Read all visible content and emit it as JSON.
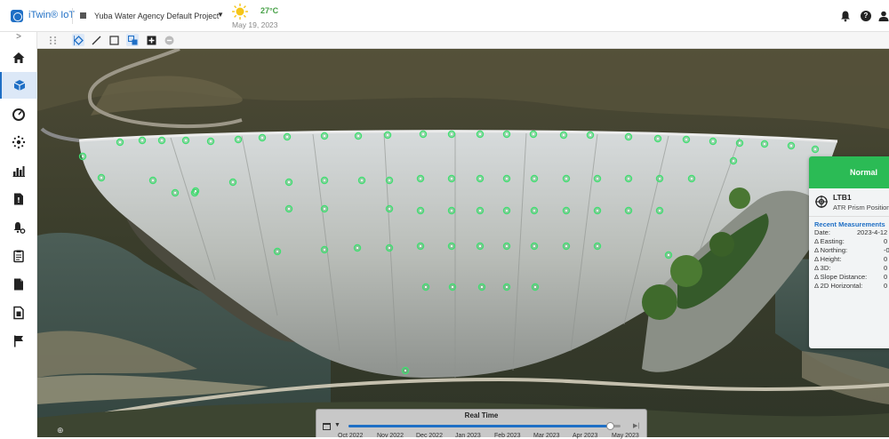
{
  "header": {
    "app_title": "iTwin® IoT",
    "project_name": "Yuba Water Agency Default Project",
    "weather_icon": "sun-icon",
    "temperature": "27°C",
    "date": "May 19, 2023",
    "icons": [
      "bell-icon",
      "help-icon",
      "user-icon"
    ]
  },
  "sidebar": {
    "collapse_glyph": ">",
    "items": [
      {
        "icon": "home-icon",
        "active": false
      },
      {
        "icon": "cube-icon",
        "active": true
      },
      {
        "icon": "gauge-icon",
        "active": false
      },
      {
        "icon": "network-icon",
        "active": false
      },
      {
        "icon": "bar-chart-icon",
        "active": false
      },
      {
        "icon": "alert-document-icon",
        "active": false
      },
      {
        "icon": "bell-settings-icon",
        "active": false
      },
      {
        "icon": "clipboard-icon",
        "active": false
      },
      {
        "icon": "document-icon",
        "active": false
      },
      {
        "icon": "report-icon",
        "active": false
      },
      {
        "icon": "flag-icon",
        "active": false
      }
    ]
  },
  "toolbar": {
    "tools": [
      "drag-handle-icon",
      "select-icon",
      "line-icon",
      "rectangle-icon",
      "group-icon",
      "add-icon",
      "remove-icon"
    ]
  },
  "panel": {
    "status": "Normal",
    "status_color": "#2bbb55",
    "sensor_name": "LTB1",
    "sensor_type": "ATR Prism Position",
    "recent_title": "Recent Measurements",
    "measurements": [
      {
        "label": "Date:",
        "value": "2023-4-12"
      },
      {
        "label": "Δ Easting:",
        "value": "0"
      },
      {
        "label": "Δ Northing:",
        "value": "-0"
      },
      {
        "label": "Δ Height:",
        "value": "0"
      },
      {
        "label": "Δ 3D:",
        "value": "0"
      },
      {
        "label": "Δ Slope Distance:",
        "value": "0"
      },
      {
        "label": "Δ 2D Horizontal:",
        "value": "0"
      }
    ]
  },
  "timeline": {
    "title": "Real Time",
    "months": [
      "Oct 2022",
      "Nov 2022",
      "Dec 2022",
      "Jan 2023",
      "Feb 2023",
      "Mar 2023",
      "Apr 2023",
      "May 2023"
    ],
    "progress": 0.96
  },
  "colors": {
    "accent": "#1f6fc5",
    "sensor_marker": "#3fe070",
    "normal": "#2bbb55"
  }
}
